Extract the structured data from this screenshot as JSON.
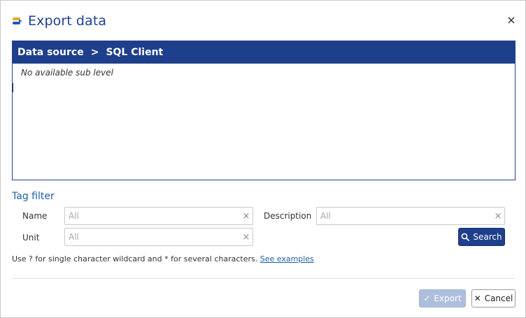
{
  "dialog": {
    "title": "Export data",
    "close_glyph": "×",
    "icon": "export-data-icon"
  },
  "browser": {
    "crumbs": [
      "Data source",
      "SQL Client"
    ],
    "separator": ">",
    "empty_message": "No available sub level"
  },
  "tag_filter": {
    "title": "Tag filter",
    "name_label": "Name",
    "name_value": "",
    "name_placeholder": "All",
    "description_label": "Description",
    "description_value": "",
    "description_placeholder": "All",
    "unit_label": "Unit",
    "unit_value": "",
    "unit_placeholder": "All",
    "clear_glyph": "×",
    "search_label": "Search",
    "hint_text": "Use ? for single character wildcard and * for several characters.",
    "hint_link": "See examples"
  },
  "footer": {
    "export_label": "Export",
    "cancel_label": "Cancel",
    "check_glyph": "✓",
    "cancel_glyph": "✕"
  },
  "colors": {
    "accent": "#1e3f8c",
    "title": "#1f3f8f",
    "section_title": "#1f5fa8",
    "export_disabled": "#aebfdd"
  }
}
